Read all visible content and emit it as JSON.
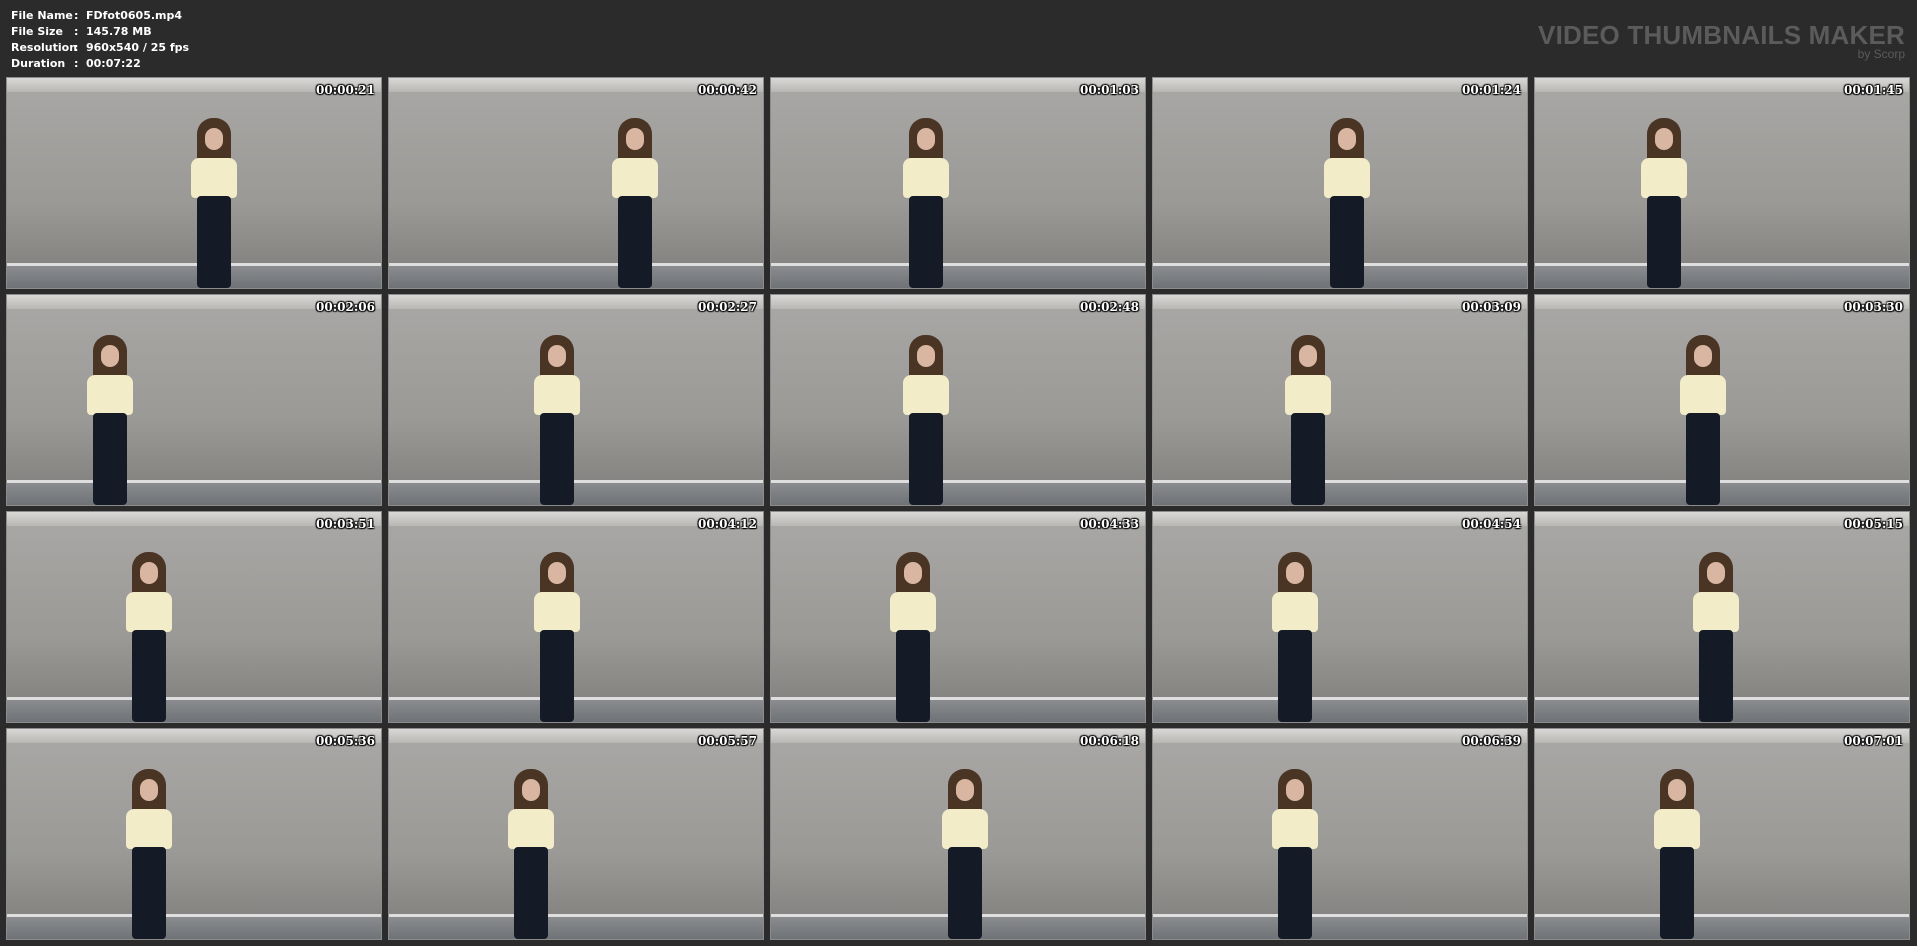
{
  "meta": {
    "rows": [
      {
        "label": "File Name",
        "value": "FDfot0605.mp4"
      },
      {
        "label": "File Size",
        "value": "145.78 MB"
      },
      {
        "label": "Resolution",
        "value": "960x540 / 25 fps"
      },
      {
        "label": "Duration",
        "value": "00:07:22"
      }
    ],
    "separator": ":"
  },
  "brand": {
    "title": "VIDEO THUMBNAILS MAKER",
    "subtitle": "by Scorp"
  },
  "thumbnails": [
    {
      "time": "00:00:21"
    },
    {
      "time": "00:00:42"
    },
    {
      "time": "00:01:03"
    },
    {
      "time": "00:01:24"
    },
    {
      "time": "00:01:45"
    },
    {
      "time": "00:02:06"
    },
    {
      "time": "00:02:27"
    },
    {
      "time": "00:02:48"
    },
    {
      "time": "00:03:09"
    },
    {
      "time": "00:03:30"
    },
    {
      "time": "00:03:51"
    },
    {
      "time": "00:04:12"
    },
    {
      "time": "00:04:33"
    },
    {
      "time": "00:04:54"
    },
    {
      "time": "00:05:15"
    },
    {
      "time": "00:05:36"
    },
    {
      "time": "00:05:57"
    },
    {
      "time": "00:06:18"
    },
    {
      "time": "00:06:39"
    },
    {
      "time": "00:07:01"
    }
  ],
  "colors": {
    "background": "#2b2b2b",
    "brand_text": "#5b5b5b",
    "thumb_border": "#8c8c8c"
  }
}
